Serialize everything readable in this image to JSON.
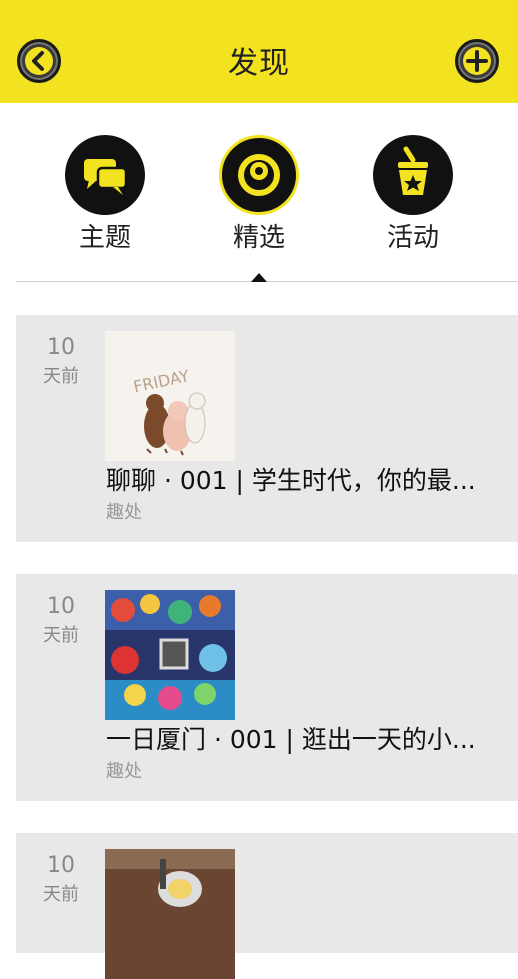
{
  "header": {
    "title": "发现",
    "back_icon": "chevron-left-icon",
    "add_icon": "plus-icon",
    "accent_color": "#f2e21f"
  },
  "categories": [
    {
      "label": "主题",
      "icon": "chat-bubbles-icon",
      "selected": false
    },
    {
      "label": "精选",
      "icon": "target-ring-icon",
      "selected": true
    },
    {
      "label": "活动",
      "icon": "ice-bucket-star-icon",
      "selected": false
    }
  ],
  "feed": [
    {
      "days_num": "10",
      "days_unit": "天前",
      "title": "聊聊 · 001 | 学生时代，你的最...",
      "source": "趣处",
      "thumb": "friday-pigs-illustration"
    },
    {
      "days_num": "10",
      "days_unit": "天前",
      "title": "一日厦门 · 001 | 逛出一天的小...",
      "source": "趣处",
      "thumb": "graffiti-wall-photo"
    },
    {
      "days_num": "10",
      "days_unit": "天前",
      "title": "",
      "source": "",
      "thumb": "food-table-photo"
    }
  ]
}
